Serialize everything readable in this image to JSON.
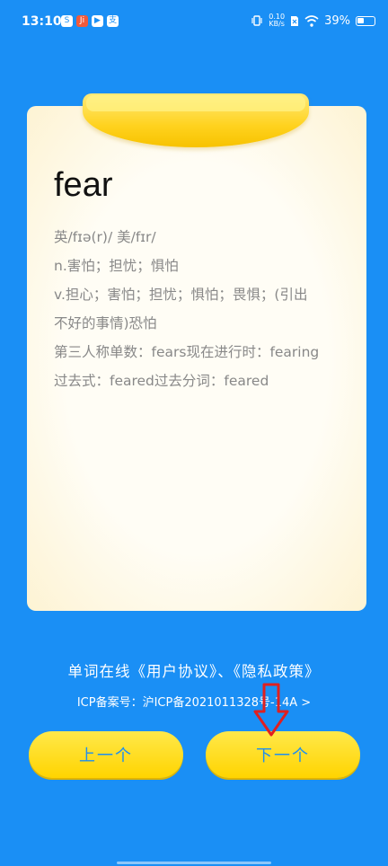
{
  "status_bar": {
    "time": "13:10",
    "apps": [
      "S",
      "Ji",
      "▶",
      "支"
    ],
    "net_speed_top": "0.10",
    "net_speed_bottom": "KB/s",
    "battery": "39%",
    "battery_level": 0.39
  },
  "card": {
    "word": "fear",
    "phonetic": "英/fɪə(r)/ 美/fɪr/",
    "noun": "n.害怕；担忧；惧怕",
    "verb_line1": "v.担心；害怕；担忧；惧怕；畏惧；(引出",
    "verb_line2": "不好的事情)恐怕",
    "forms_line1": "第三人称单数：fears现在进行时：fearing",
    "forms_line2": "过去式：feared过去分词：feared"
  },
  "footer": {
    "agreement": "单词在线《用户协议》、《隐私政策》",
    "icp": "ICP备案号：沪ICP备2021011328号-14A >"
  },
  "buttons": {
    "prev": "上一个",
    "next": "下一个"
  },
  "colors": {
    "background": "#1a8ff5",
    "button": "#ffd400",
    "button_text": "#1e8ef0",
    "annotation_arrow": "#e02020"
  }
}
